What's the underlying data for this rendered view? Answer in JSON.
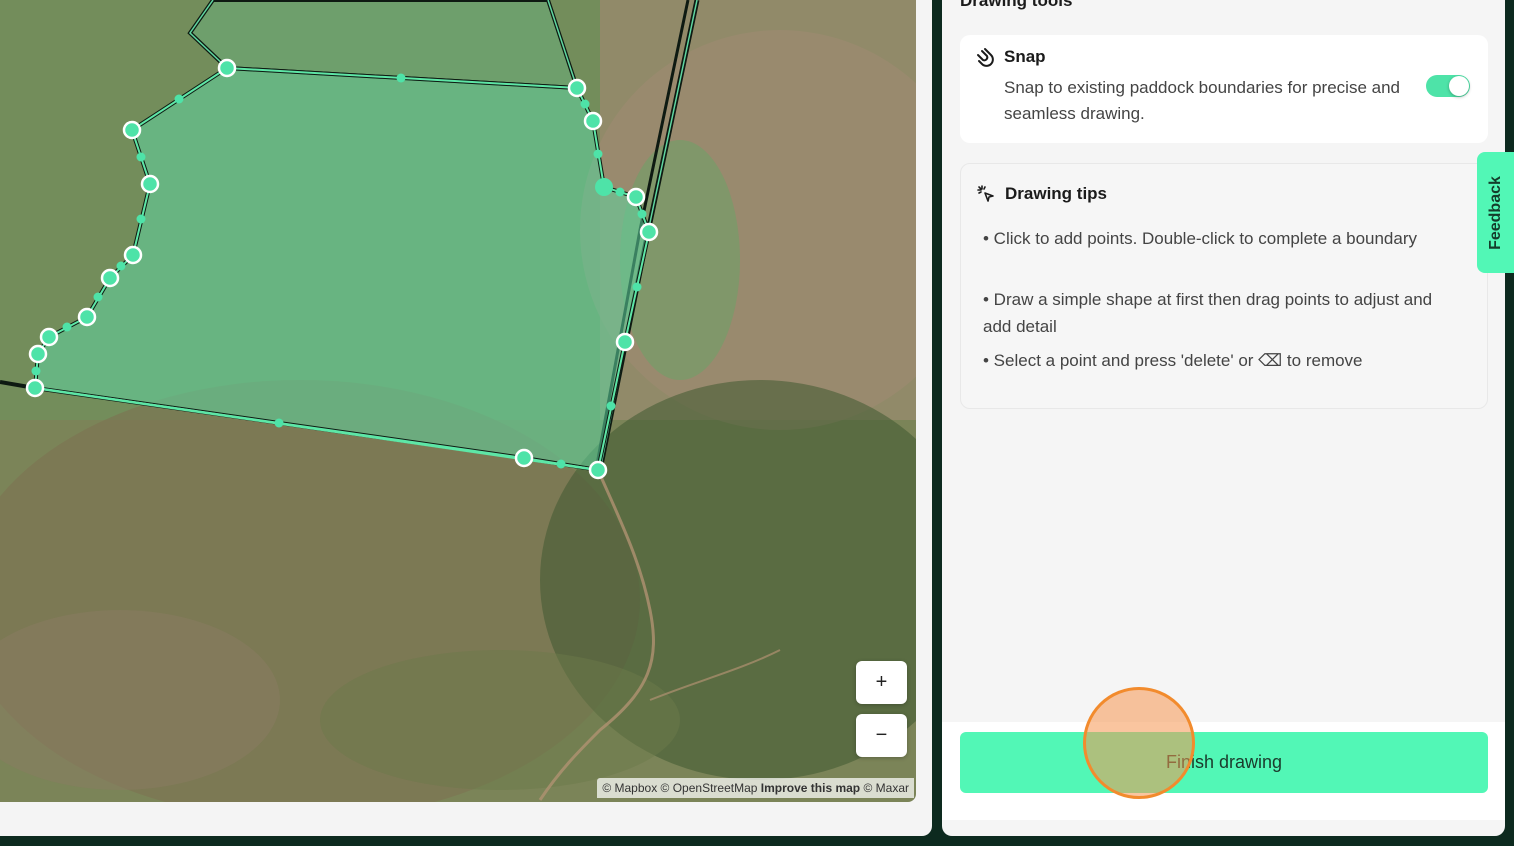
{
  "map": {
    "zoom_in_label": "+",
    "zoom_out_label": "−",
    "attribution": {
      "mapbox": "© Mapbox",
      "osm": "© OpenStreetMap",
      "improve": "Improve this map",
      "maxar": "© Maxar"
    }
  },
  "panel": {
    "section_title": "Drawing tools",
    "snap": {
      "title": "Snap",
      "description": "Snap to existing paddock boundaries for precise and seamless drawing.",
      "enabled": true,
      "icon": "magnet-icon"
    },
    "tips": {
      "title": "Drawing tips",
      "icon": "sparkle-cursor-icon",
      "items": [
        "• Click to add points. Double-click to complete a boundary",
        "• Draw a simple shape at first then drag points to adjust and add detail",
        "• Select a point and press 'delete' or ⌫ to remove"
      ]
    },
    "finish_button": "Finish drawing"
  },
  "feedback_label": "Feedback",
  "colors": {
    "accent": "#52f7b6",
    "polygon_fill": "#5fd6a0",
    "boundary_dark": "#0e1a12",
    "click_marker": "#f28b2d"
  }
}
